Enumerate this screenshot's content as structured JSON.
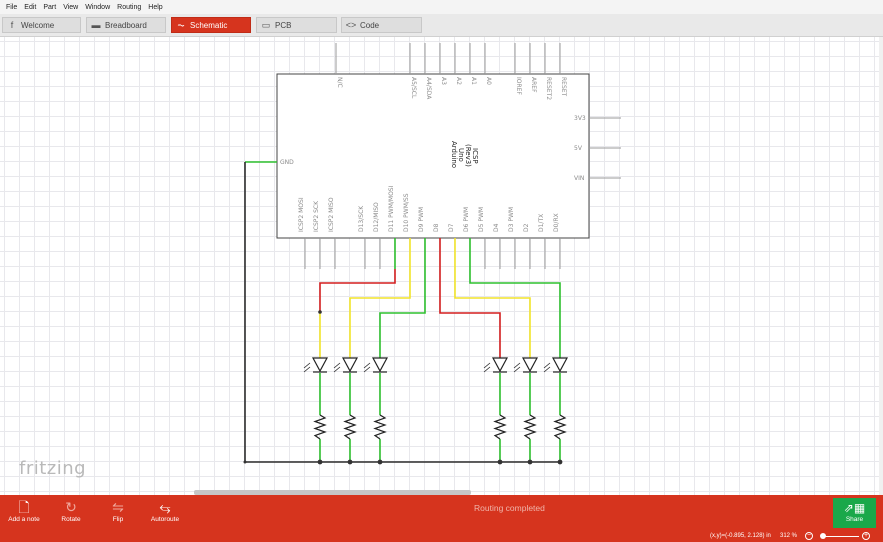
{
  "menu": [
    "File",
    "Edit",
    "Part",
    "View",
    "Window",
    "Routing",
    "Help"
  ],
  "tabs": [
    {
      "label": "Welcome",
      "icon": "f"
    },
    {
      "label": "Breadboard",
      "icon": "▬"
    },
    {
      "label": "Schematic",
      "icon": "⏦"
    },
    {
      "label": "PCB",
      "icon": "▭"
    },
    {
      "label": "Code",
      "icon": "<>"
    }
  ],
  "board": {
    "title": "Arduino",
    "model": "Uno",
    "rev": "(Rev3)",
    "variant": "ICSP",
    "pins_top": [
      "N/C",
      "A5/SCL",
      "A4/SDA",
      "A3",
      "A2",
      "A1",
      "A0",
      "IOREF",
      "AREF",
      "RESET2",
      "RESET"
    ],
    "pins_right": [
      "3V3",
      "5V",
      "VIN"
    ],
    "pins_left": [
      "GND"
    ],
    "pins_bottom": [
      "ICSP2 MOSI",
      "ICSP2 SCK",
      "ICSP2 MISO",
      "D13/SCK",
      "D12/MISO",
      "D11 PWM/MOSI",
      "D10 PWM/SS",
      "D9 PWM",
      "D8",
      "D7",
      "D6 PWM",
      "D5 PWM",
      "D4",
      "D3 PWM",
      "D2",
      "D1/TX",
      "D0/RX"
    ]
  },
  "wire_colors": {
    "green": "#2ec02e",
    "red": "#d31f1f",
    "yellow": "#f2e42a",
    "black": "#2b2b2b"
  },
  "watermark": "fritzing",
  "toolbar": [
    {
      "label": "Add a note",
      "icon": "note-icon"
    },
    {
      "label": "Rotate",
      "icon": "rotate-icon"
    },
    {
      "label": "Flip",
      "icon": "flip-icon"
    },
    {
      "label": "Autoroute",
      "icon": "autoroute-icon"
    }
  ],
  "status_message": "Routing completed",
  "share_label": "Share",
  "coords": "(x,y)=(-0.895, 2.128) in",
  "zoom": "312 %"
}
